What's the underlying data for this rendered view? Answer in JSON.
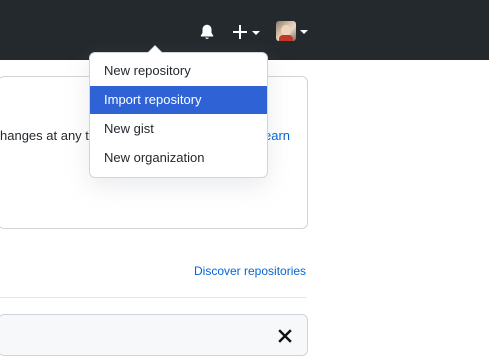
{
  "header": {
    "icons": [
      "bell-icon",
      "plus-icon",
      "avatar"
    ]
  },
  "create_menu": {
    "items": [
      {
        "label": "New repository",
        "active": false
      },
      {
        "label": "Import repository",
        "active": true
      },
      {
        "label": "New gist",
        "active": false
      },
      {
        "label": "New organization",
        "active": false
      }
    ]
  },
  "main": {
    "card_text": "hanges at any t",
    "card_link": "earn",
    "discover_label": "Discover repositories",
    "close_glyph": "×"
  },
  "colors": {
    "header_bg": "#24292e",
    "menu_highlight": "#2f63d5",
    "link": "#0366d6"
  }
}
